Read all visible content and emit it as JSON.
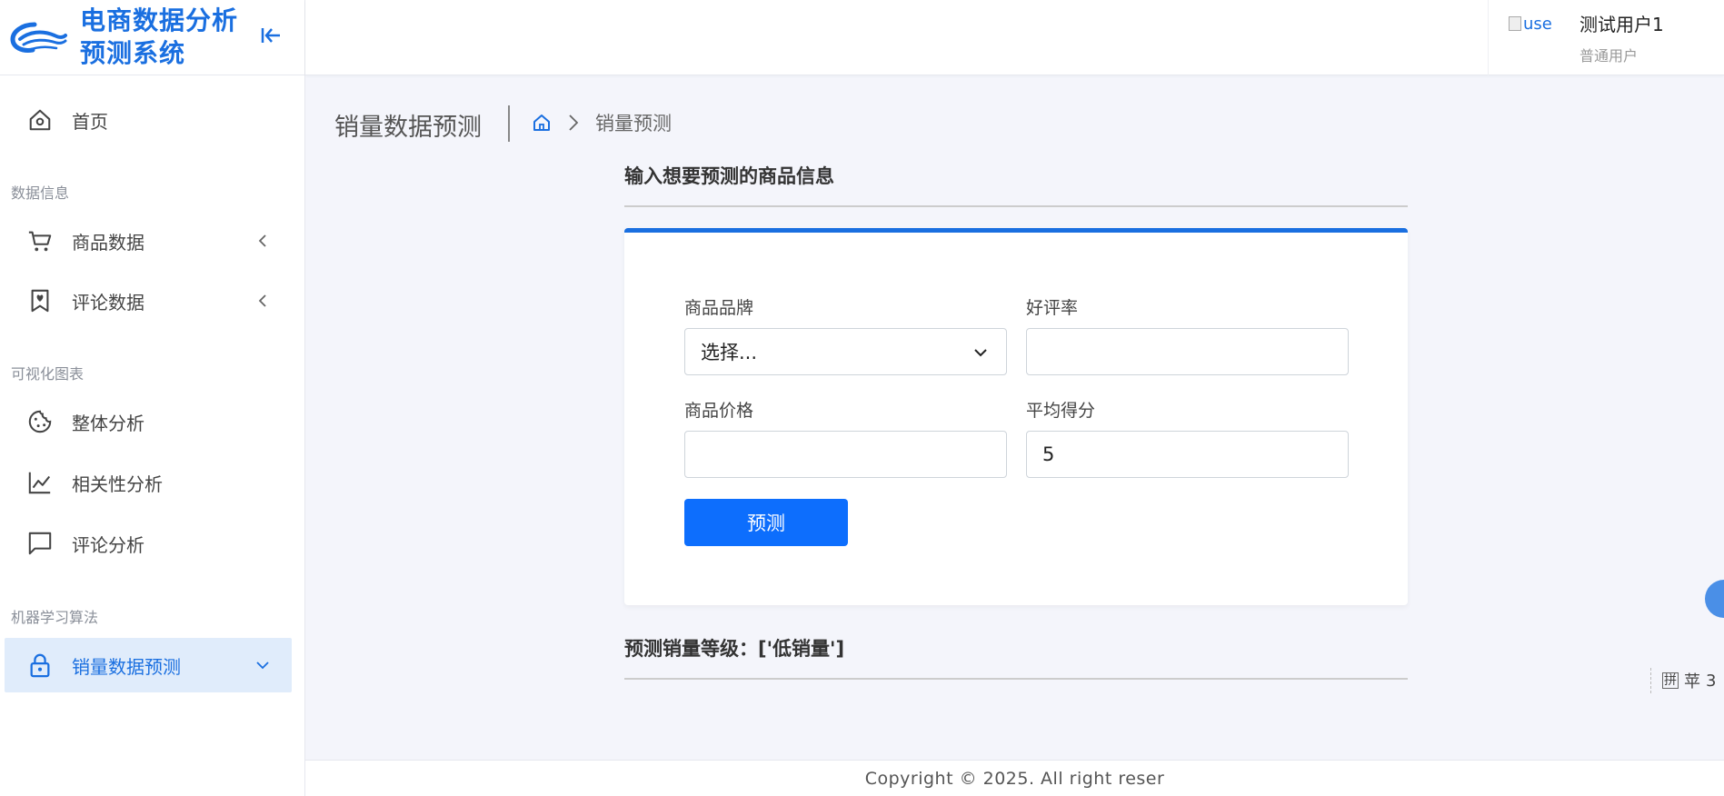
{
  "brand": {
    "title_line1": "电商数据分析",
    "title_line2": "预测系统",
    "accent_color": "#1a6fe0"
  },
  "sidebar": {
    "home_label": "首页",
    "sections": [
      {
        "label": "数据信息"
      },
      {
        "label": "可视化图表"
      },
      {
        "label": "机器学习算法"
      }
    ],
    "items": [
      {
        "label": "商品数据",
        "icon": "cart-icon"
      },
      {
        "label": "评论数据",
        "icon": "bookmark-heart-icon"
      },
      {
        "label": "整体分析",
        "icon": "cookie-icon"
      },
      {
        "label": "相关性分析",
        "icon": "line-chart-icon"
      },
      {
        "label": "评论分析",
        "icon": "chat-icon"
      },
      {
        "label": "销量数据预测",
        "icon": "lock-icon",
        "active": true
      }
    ]
  },
  "header": {
    "avatar_alt": "use",
    "user_name": "测试用户1",
    "user_role": "普通用户"
  },
  "page": {
    "title": "销量数据预测",
    "breadcrumb_current": "销量预测"
  },
  "form": {
    "heading": "输入想要预测的商品信息",
    "brand_label": "商品品牌",
    "brand_value": "选择...",
    "rating_label": "好评率",
    "rating_value": "",
    "price_label": "商品价格",
    "price_value": "",
    "score_label": "平均得分",
    "score_value": "5",
    "submit_label": "预测",
    "button_color": "#0d6efd"
  },
  "result": {
    "text": "预测销量等级：['低销量']"
  },
  "footer": {
    "copyright": "Copyright © 2025. All right reser"
  },
  "ime": {
    "k1": "拼",
    "k2": "苹",
    "k3": "3"
  }
}
